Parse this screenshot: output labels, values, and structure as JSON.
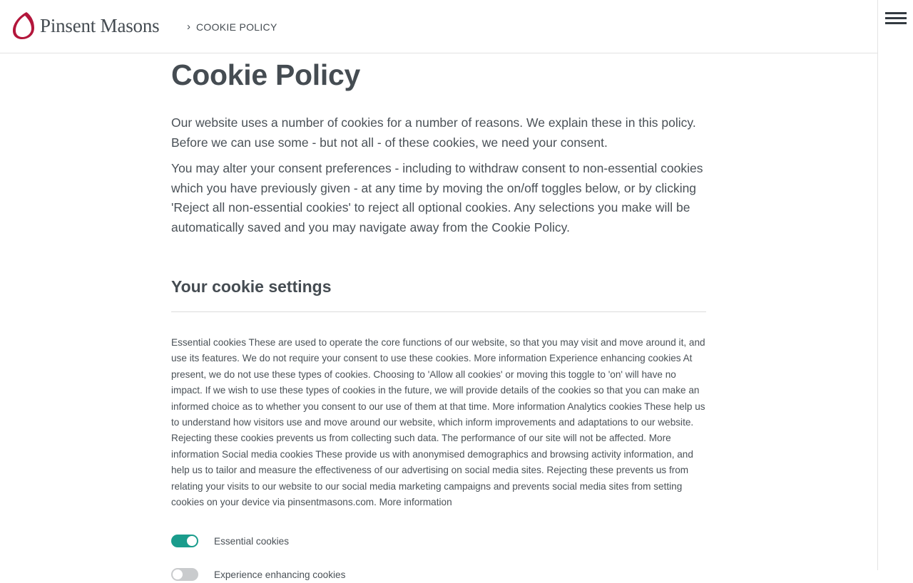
{
  "header": {
    "logo_text": "Pinsent Masons",
    "brand_color": "#b3163b",
    "breadcrumb": {
      "chevron": "›",
      "current": "COOKIE POLICY"
    }
  },
  "side_rail": {
    "menu_icon": "hamburger-menu-icon"
  },
  "main": {
    "title": "Cookie Policy",
    "intro_paragraphs": [
      "Our website uses a number of cookies for a number of reasons. We explain these in this policy. Before we can use some - but not all - of these cookies, we need your consent.",
      "You may alter your consent preferences - including to withdraw consent to non-essential cookies which you have previously given - at any time by moving the on/off toggles below, or by clicking 'Reject all non-essential cookies' to reject all optional cookies.  Any selections you make will be automatically saved and you may navigate away from the Cookie Policy."
    ],
    "settings_title": "Your cookie settings",
    "cookie_description": "Essential cookies These are used to operate the core functions of our website, so that you may visit and move around it, and use its features. We do not require your consent to use these cookies. More information Experience enhancing cookies At present, we do not use these types of cookies. Choosing to 'Allow all cookies' or moving this toggle to 'on' will have no impact. If we wish to use these types of cookies in the future, we will provide details of the cookies so that you can make an informed choice as to whether you consent to our use of them at that time. More information Analytics cookies These help us to understand how visitors use and move around our website, which inform improvements and adaptations to our website. Rejecting these cookies prevents us from collecting such data. The performance of our site will not be affected. More information Social media cookies These provide us with anonymised demographics and browsing activity information, and help us to tailor and measure the effectiveness of our advertising on social media sites. Rejecting these prevents us from relating your visits to our website to our social media marketing campaigns and prevents social media sites from setting cookies on your device via pinsentmasons.com. More information",
    "toggles": [
      {
        "label": "Essential cookies",
        "state": "on"
      },
      {
        "label": "Experience enhancing cookies",
        "state": "off"
      }
    ]
  },
  "colors": {
    "toggle_on": "#1a9c8c",
    "toggle_off": "#c9cbcd",
    "heading": "#454c52"
  }
}
